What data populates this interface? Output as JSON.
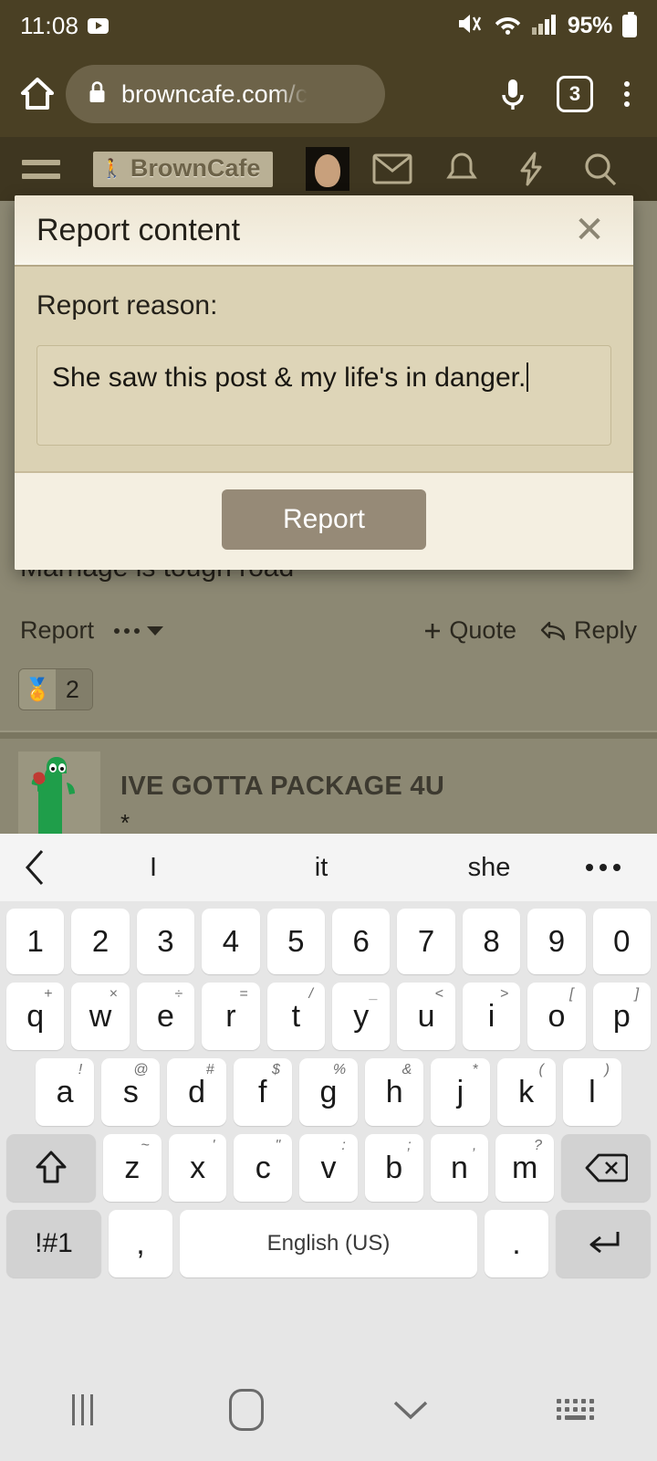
{
  "statusbar": {
    "time": "11:08",
    "battery_percent": "95%",
    "icons": [
      "youtube-badge-icon",
      "mute-vibrate-icon",
      "wifi-icon",
      "signal-icon",
      "battery-icon"
    ]
  },
  "browser": {
    "url": "browncafe.com/c",
    "tab_count": "3",
    "icons": [
      "home-icon",
      "lock-icon",
      "microphone-icon",
      "tab-switcher-icon",
      "overflow-menu-icon"
    ]
  },
  "site_header": {
    "logo": "BrownCafe",
    "logo_mark": "🚶",
    "icons": [
      "hamburger-icon",
      "avatar",
      "mail-icon",
      "bell-icon",
      "bolt-icon",
      "search-icon"
    ]
  },
  "modal": {
    "title": "Report content",
    "close_label": "✕",
    "reason_label": "Report reason:",
    "reason_value": "She saw this post & my life's in danger.",
    "reason_placeholder": "",
    "submit_label": "Report"
  },
  "page": {
    "post_title": "Marriage is tough road",
    "actions": {
      "report": "Report",
      "quote": "+ Quote",
      "quote_label": "Quote",
      "reply": "Reply"
    },
    "reaction": {
      "emoji": "🏅",
      "count": "2"
    },
    "next_post": {
      "title": "IVE GOTTA PACKAGE 4U",
      "subtext": "*"
    }
  },
  "keyboard": {
    "suggestions": [
      "I",
      "it",
      "she"
    ],
    "rows": {
      "numbers": [
        {
          "label": "1"
        },
        {
          "label": "2"
        },
        {
          "label": "3"
        },
        {
          "label": "4"
        },
        {
          "label": "5"
        },
        {
          "label": "6"
        },
        {
          "label": "7"
        },
        {
          "label": "8"
        },
        {
          "label": "9"
        },
        {
          "label": "0"
        }
      ],
      "qwerty": [
        {
          "label": "q",
          "sup": "+"
        },
        {
          "label": "w",
          "sup": "×"
        },
        {
          "label": "e",
          "sup": "÷"
        },
        {
          "label": "r",
          "sup": "="
        },
        {
          "label": "t",
          "sup": "/"
        },
        {
          "label": "y",
          "sup": "_"
        },
        {
          "label": "u",
          "sup": "<"
        },
        {
          "label": "i",
          "sup": ">"
        },
        {
          "label": "o",
          "sup": "["
        },
        {
          "label": "p",
          "sup": "]"
        }
      ],
      "asdf": [
        {
          "label": "a",
          "sup": "!"
        },
        {
          "label": "s",
          "sup": "@"
        },
        {
          "label": "d",
          "sup": "#"
        },
        {
          "label": "f",
          "sup": "$"
        },
        {
          "label": "g",
          "sup": "%"
        },
        {
          "label": "h",
          "sup": "&"
        },
        {
          "label": "j",
          "sup": "*"
        },
        {
          "label": "k",
          "sup": "("
        },
        {
          "label": "l",
          "sup": ")"
        }
      ],
      "zxcv": [
        {
          "label": "z",
          "sup": "~"
        },
        {
          "label": "x",
          "sup": "'"
        },
        {
          "label": "c",
          "sup": "\""
        },
        {
          "label": "v",
          "sup": ":"
        },
        {
          "label": "b",
          "sup": ";"
        },
        {
          "label": "n",
          "sup": ","
        },
        {
          "label": "m",
          "sup": "?"
        }
      ]
    },
    "shift_label": "⇧",
    "backspace_label": "⌫",
    "symbols_label": "!#1",
    "comma_label": ",",
    "space_label": "English (US)",
    "period_label": ".",
    "enter_label": "↵"
  },
  "navbar": {
    "items": [
      "recents-icon",
      "home-icon",
      "keyboard-down-icon",
      "keyboard-toggle-icon"
    ]
  },
  "colors": {
    "chrome": "#4a4024",
    "page_overlay": "#8c8873",
    "modal_body": "#dbd2b4",
    "modal_header": "#f2ecdd",
    "modal_footer": "#f4efe1",
    "report_button": "#968a77",
    "keyboard_bg": "#e6e6e6",
    "key_bg": "#ffffff",
    "mod_key_bg": "#d2d2d2"
  }
}
